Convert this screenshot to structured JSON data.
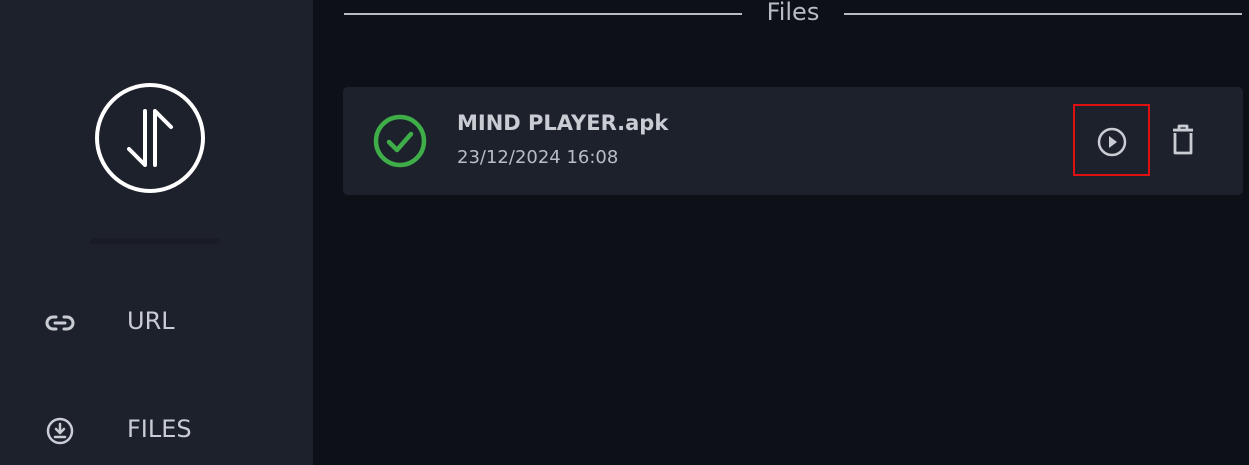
{
  "sidebar": {
    "logo_icon": "transfer-arrows-logo",
    "items": [
      {
        "label": "URL",
        "icon": "link-icon"
      },
      {
        "label": "FILES",
        "icon": "download-circle-icon"
      }
    ]
  },
  "main": {
    "section_title": "Files",
    "files": [
      {
        "name": "MIND PLAYER.apk",
        "date": "23/12/2024 16:08",
        "status_icon": "check-circle-icon",
        "actions": [
          "play-circle-icon",
          "trash-icon"
        ]
      }
    ]
  },
  "colors": {
    "background": "#0d1117",
    "sidebar": "#1d212b",
    "card": "#1d212b",
    "success": "#3fae49",
    "text": "#c9cdd3",
    "highlight": "#e01010"
  }
}
